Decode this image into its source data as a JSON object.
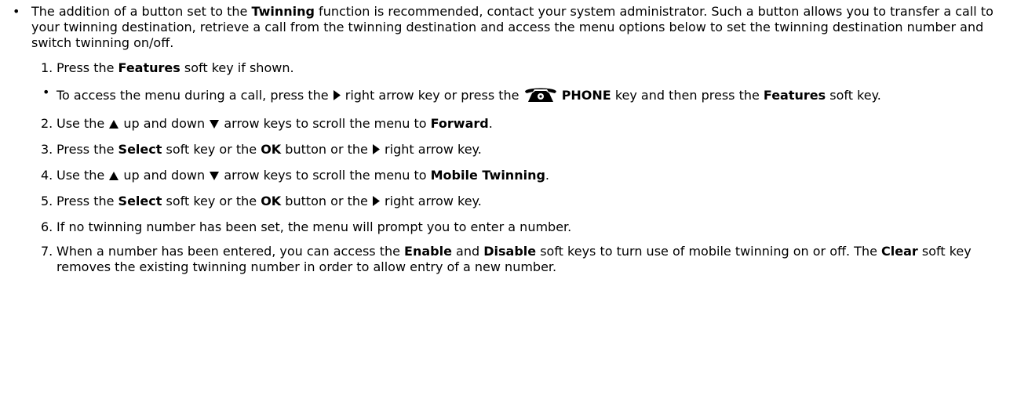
{
  "intro": {
    "before": "The addition of a button set to the ",
    "bold": "Twinning",
    "after": " function is recommended, contact your system administrator. Such a button allows you to transfer a call to your twinning destination, retrieve a call from the twinning destination and access the menu options below to set the twinning destination number and switch twinning on/off."
  },
  "steps": [
    {
      "num": "1.",
      "t1": "Press the ",
      "b1": "Features",
      "t2": " soft key if shown."
    },
    {
      "num": "2.",
      "t1": "Use the ",
      "t2": " up and down ",
      "t3": " arrow keys to scroll the menu to ",
      "b1": "Forward",
      "t4": "."
    },
    {
      "num": "3.",
      "t1": "Press the ",
      "b1": "Select",
      "t2": " soft key or the ",
      "b2": "OK",
      "t3": " button or the ",
      "t4": " right arrow key."
    },
    {
      "num": "4.",
      "t1": "Use the ",
      "t2": " up and down ",
      "t3": " arrow keys to scroll the menu to ",
      "b1": "Mobile Twinning",
      "t4": "."
    },
    {
      "num": "5.",
      "t1": "Press the ",
      "b1": "Select",
      "t2": " soft key or the ",
      "b2": "OK",
      "t3": " button or the ",
      "t4": " right arrow key."
    },
    {
      "num": "6.",
      "t1": "If no twinning number has been set, the menu will prompt you to enter a number."
    },
    {
      "num": "7.",
      "t1": "When a number has been entered, you can access the ",
      "b1": "Enable",
      "t2": " and ",
      "b2": "Disable",
      "t3": " soft keys to turn use of mobile twinning on or off. The ",
      "b3": "Clear",
      "t4": " soft key removes the existing twinning number in order to allow entry of a new number."
    }
  ],
  "sub": {
    "t1": "To access the menu during a call, press the ",
    "t2": " right arrow key or press the ",
    "b1": "PHONE",
    "t3": " key and then press the ",
    "b2": "Features",
    "t4": " soft key."
  },
  "icons": {
    "right_arrow": "right-arrow-key-icon",
    "up_arrow": "up-arrow-key-icon",
    "down_arrow": "down-arrow-key-icon",
    "phone": "phone-key-icon"
  }
}
